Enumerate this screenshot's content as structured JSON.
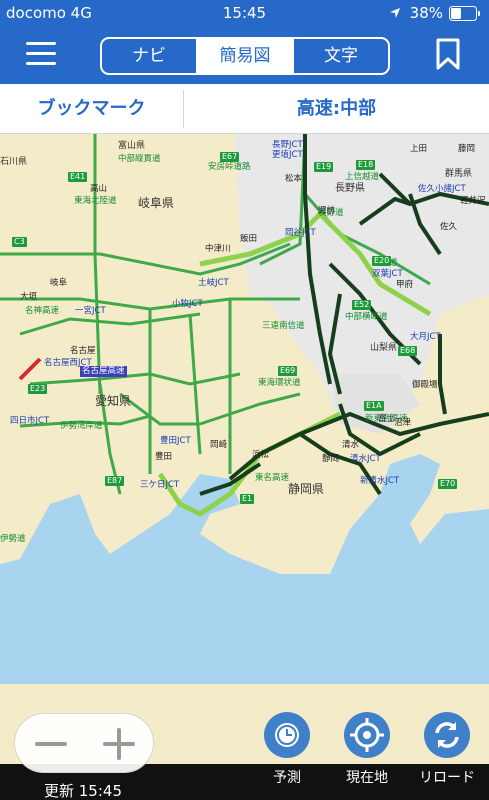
{
  "status": {
    "carrier": "docomo 4G",
    "time": "15:45",
    "battery": "38%"
  },
  "tabs": [
    "ナビ",
    "簡易図",
    "文字"
  ],
  "subbar": {
    "bookmark": "ブックマーク",
    "region": "高速:中部"
  },
  "map": {
    "prefectures": [
      "岐阜県",
      "長野県",
      "愛知県",
      "静岡県",
      "山梨県",
      "群馬県",
      "富山県",
      "石川県"
    ],
    "expressway_labels": [
      "中部縦貫道",
      "安房峠道路",
      "長野道",
      "上信越道",
      "中央道",
      "中部横断道",
      "東海北陸道",
      "名神高速",
      "東名高速",
      "新東名高速",
      "伊勢湾岸道",
      "三遠南信道",
      "東海環状道",
      "名古屋高速",
      "伊勢道"
    ],
    "route_shields": [
      "E67",
      "E19",
      "E20",
      "E52",
      "E69",
      "E1A",
      "E1",
      "E41",
      "E23",
      "E87",
      "E68",
      "E70",
      "C3",
      "E18"
    ],
    "junctions": [
      "長野JCT",
      "更埴JCT",
      "岡谷JCT",
      "双葉JCT",
      "大月JCT",
      "佐久小諸JCT",
      "土岐JCT",
      "小牧JCT",
      "一宮JCT",
      "名古屋西JCT",
      "豊田JCT",
      "三ケ日JCT",
      "清水JCT",
      "新清水JCT",
      "四日市JCT"
    ],
    "places": [
      "松本",
      "諏訪",
      "甲府",
      "富士",
      "沼津",
      "清水",
      "浜松",
      "静岡",
      "豊田",
      "名古屋",
      "高山",
      "飯田",
      "中津川",
      "岐阜",
      "大垣",
      "岡崎",
      "御殿場",
      "佐久",
      "上田",
      "軽井沢",
      "藤岡"
    ]
  },
  "controls": {
    "forecast": "予測",
    "current": "現在地",
    "reload": "リロード",
    "updated": "更新 15:45"
  }
}
